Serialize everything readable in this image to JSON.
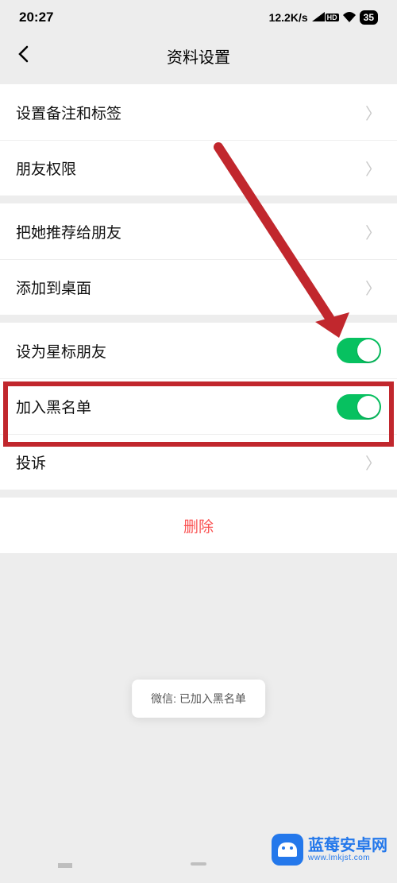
{
  "status": {
    "time": "20:27",
    "net_speed": "12.2K/s",
    "battery": "35"
  },
  "nav": {
    "title": "资料设置"
  },
  "group1": {
    "remark": "设置备注和标签",
    "privacy": "朋友权限"
  },
  "group2": {
    "recommend": "把她推荐给朋友",
    "addDesktop": "添加到桌面"
  },
  "group3": {
    "star": "设为星标朋友",
    "blacklist": "加入黑名单",
    "report": "投诉"
  },
  "delete": "删除",
  "toast": "微信: 已加入黑名单",
  "watermark": {
    "name": "蓝莓安卓网",
    "url": "www.lmkjst.com"
  }
}
